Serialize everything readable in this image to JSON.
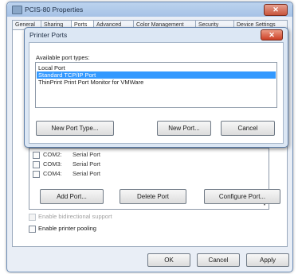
{
  "window": {
    "title": "PCIS-80 Properties",
    "close_glyph": "✕",
    "tabs": [
      "General",
      "Sharing",
      "Ports",
      "Advanced",
      "Color Management",
      "Security",
      "Device Settings"
    ],
    "active_tab": "Ports"
  },
  "ports": [
    {
      "name": "COM2:",
      "description": "Serial Port",
      "checked": false
    },
    {
      "name": "COM3:",
      "description": "Serial Port",
      "checked": false
    },
    {
      "name": "COM4:",
      "description": "Serial Port",
      "checked": false
    }
  ],
  "port_buttons": {
    "add": "Add Port...",
    "delete": "Delete Port",
    "configure": "Configure Port..."
  },
  "options": {
    "bidirectional": {
      "label": "Enable bidirectional support",
      "enabled": false,
      "checked": false
    },
    "pooling": {
      "label": "Enable printer pooling",
      "enabled": true,
      "checked": false
    }
  },
  "footer": {
    "ok": "OK",
    "cancel": "Cancel",
    "apply": "Apply"
  },
  "dialog": {
    "title": "Printer Ports",
    "close_glyph": "✕",
    "types_label": "Available port types:",
    "port_types": [
      "Local Port",
      "Standard TCP/IP Port",
      "ThinPrint Print Port Monitor for VMWare"
    ],
    "selected_type": "Standard TCP/IP Port",
    "buttons": {
      "new_type": "New Port Type...",
      "new_port": "New Port...",
      "cancel": "Cancel"
    }
  },
  "colors": {
    "selection": "#3399ff",
    "titlebar": "#a6c2e6",
    "close": "#cc3f25"
  }
}
